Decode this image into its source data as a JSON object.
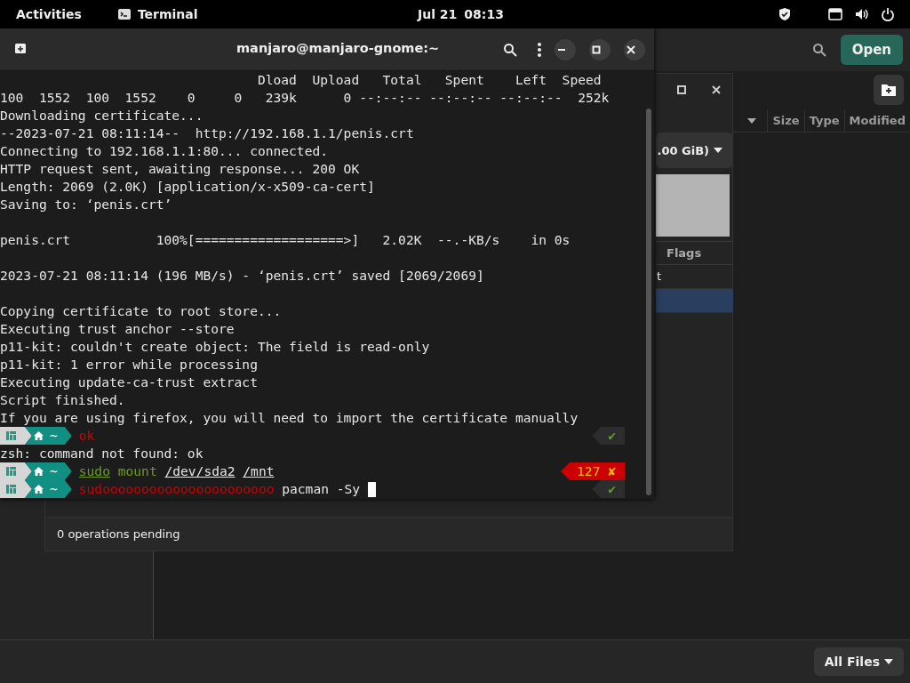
{
  "top_bar": {
    "activities": "Activities",
    "app": "Terminal",
    "date": "Jul 21",
    "time": "08:13"
  },
  "file_dialog": {
    "open_button": "Open",
    "columns": [
      "Size",
      "Type",
      "Modified"
    ],
    "filter": "All Files"
  },
  "partition_window": {
    "device": ".00 GiB)",
    "table_header": "Flags",
    "rows": [
      {
        "cell": "t",
        "selected": false
      },
      {
        "selected": true
      }
    ],
    "status": "0 operations pending"
  },
  "terminal": {
    "title": "manjaro@manjaro-gnome:~",
    "lines": [
      {
        "kind": "text",
        "text": "                                 Dload  Upload   Total   Spent    Left  Speed"
      },
      {
        "kind": "text",
        "text": "100  1552  100  1552    0     0   239k      0 --:--:-- --:--:-- --:--:--  252k"
      },
      {
        "kind": "text",
        "text": "Downloading certificate..."
      },
      {
        "kind": "text",
        "text": "--2023-07-21 08:11:14--  http://192.168.1.1/penis.crt"
      },
      {
        "kind": "text",
        "text": "Connecting to 192.168.1.1:80... connected."
      },
      {
        "kind": "text",
        "text": "HTTP request sent, awaiting response... 200 OK"
      },
      {
        "kind": "text",
        "text": "Length: 2069 (2.0K) [application/x-x509-ca-cert]"
      },
      {
        "kind": "text",
        "text": "Saving to: ‘penis.crt’"
      },
      {
        "kind": "blank"
      },
      {
        "kind": "text",
        "text": "penis.crt           100%[===================>]   2.02K  --.-KB/s    in 0s"
      },
      {
        "kind": "blank"
      },
      {
        "kind": "text",
        "text": "2023-07-21 08:11:14 (196 MB/s) - ‘penis.crt’ saved [2069/2069]"
      },
      {
        "kind": "blank"
      },
      {
        "kind": "text",
        "text": "Copying certificate to root store..."
      },
      {
        "kind": "text",
        "text": "Executing trust anchor --store"
      },
      {
        "kind": "text",
        "text": "p11-kit: couldn't create object: The field is read-only"
      },
      {
        "kind": "text",
        "text": "p11-kit: 1 error while processing"
      },
      {
        "kind": "text",
        "text": "Executing update-ca-trust extract"
      },
      {
        "kind": "text",
        "text": "Script finished."
      },
      {
        "kind": "text",
        "text": "If you are using firefox, you will need to import the certificate manually"
      },
      {
        "kind": "prompt",
        "dir": "~",
        "segments": [
          {
            "kind": "error",
            "text": "ok"
          }
        ],
        "status": {
          "kind": "ok",
          "text": "✔"
        }
      },
      {
        "kind": "text",
        "text": "zsh: command not found: ok"
      },
      {
        "kind": "prompt",
        "dir": "~",
        "segments": [
          {
            "kind": "command-underlined",
            "text": "sudo"
          },
          {
            "kind": "command",
            "text": "mount"
          },
          {
            "kind": "path",
            "text": "/dev/sda2"
          },
          {
            "kind": "path",
            "text": "/mnt"
          }
        ],
        "status": {
          "kind": "error",
          "text": "127 ✘"
        }
      },
      {
        "kind": "prompt",
        "dir": "~",
        "segments": [
          {
            "kind": "error",
            "text": "sudoooooooooooooooooooooo"
          },
          {
            "kind": "plain",
            "text": "pacman -Sy"
          }
        ],
        "cursor": true,
        "status": {
          "kind": "ok",
          "text": "✔"
        }
      }
    ]
  }
}
